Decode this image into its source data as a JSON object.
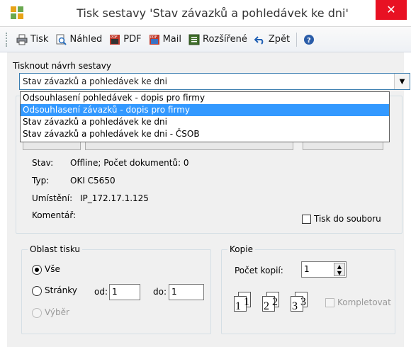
{
  "window": {
    "title": "Tisk sestavy 'Stav závazků a pohledávek ke dni'",
    "close_glyph": "✕"
  },
  "toolbar": {
    "print": "Tisk",
    "preview": "Náhled",
    "pdf": "PDF",
    "mail": "Mail",
    "advanced": "Rozšířené",
    "back": "Zpět"
  },
  "report": {
    "label": "Tisknout návrh sestavy",
    "selected": "Stav závazků a pohledávek ke dni",
    "options": [
      "Odsouhlasení pohledávek - dopis pro firmy",
      "Odsouhlasení závazků - dopis pro firmy",
      "Stav závazků a pohledávek ke dni",
      "Stav závazků a pohledávek ke dni - ČSOB"
    ],
    "highlighted_index": 1
  },
  "printer": {
    "status_label": "Stav:",
    "status_value": "Offline; Počet dokumentů: 0",
    "type_label": "Typ:",
    "type_value": "OKI C5650",
    "location_label": "Umístění:",
    "location_value": "IP_172.17.1.125",
    "comment_label": "Komentář:",
    "print_to_file": "Tisk do souboru"
  },
  "range": {
    "title": "Oblast tisku",
    "all": "Vše",
    "pages": "Stránky",
    "from_label": "od:",
    "from_value": "1",
    "to_label": "do:",
    "to_value": "1",
    "selection": "Výběr"
  },
  "copies": {
    "title": "Kopie",
    "count_label": "Počet kopií:",
    "count_value": "1",
    "collate": "Kompletovat"
  }
}
